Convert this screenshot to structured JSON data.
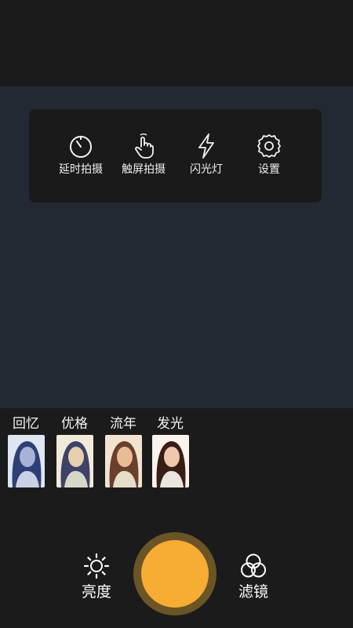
{
  "camera_settings": {
    "items": [
      {
        "label": "延时拍摄",
        "icon": "timer-icon"
      },
      {
        "label": "触屏拍摄",
        "icon": "touch-hand-icon"
      },
      {
        "label": "闪光灯",
        "icon": "flash-icon"
      },
      {
        "label": "设置",
        "icon": "gear-icon"
      }
    ]
  },
  "filters": {
    "items": [
      {
        "label": "回忆",
        "tint": "#7f93c2"
      },
      {
        "label": "优格",
        "tint": "#d8c7a7"
      },
      {
        "label": "流年",
        "tint": "#d7b08e"
      },
      {
        "label": "发光",
        "tint": "#e9d6c7"
      }
    ]
  },
  "controls": {
    "brightness_label": "亮度",
    "filter_label": "滤镜"
  },
  "colors": {
    "shutter": "#f7ac33",
    "shutter_ring": "#6b5426",
    "viewfinder": "#232932",
    "background": "#1b1b1b"
  }
}
